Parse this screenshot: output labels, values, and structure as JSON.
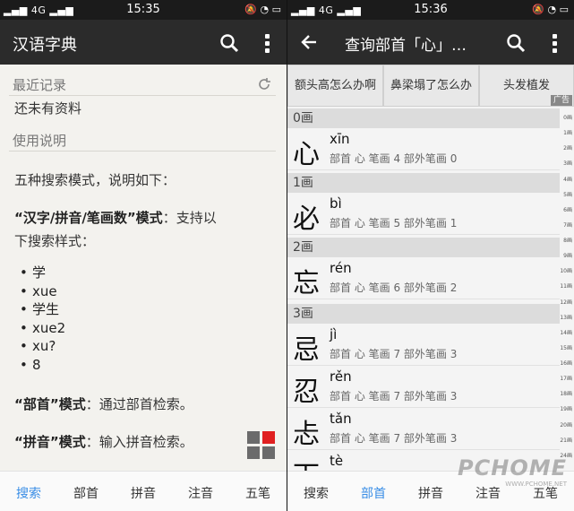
{
  "left": {
    "status": {
      "signal": "4G",
      "time": "15:35"
    },
    "appbar": {
      "title": "汉语字典"
    },
    "recent": {
      "header": "最近记录",
      "empty": "还未有资料"
    },
    "usage": {
      "header": "使用说明",
      "intro": "五种搜索模式，说明如下：",
      "mode1_bold": "“汉字/拼音/笔画数”模式",
      "mode1_rest": "：支持以",
      "mode1_cont": "下搜索样式：",
      "examples": [
        "学",
        "xue",
        "学生",
        "xue2",
        "xu?",
        "8"
      ],
      "mode2_bold": "“部首”模式",
      "mode2_rest": "：通过部首检索。",
      "mode3_bold": "“拼音”模式",
      "mode3_rest": "：输入拼音检索。"
    },
    "tabs": [
      "搜索",
      "部首",
      "拼音",
      "注音",
      "五笔"
    ],
    "active_tab": "搜索"
  },
  "right": {
    "status": {
      "signal": "4G",
      "time": "15:36"
    },
    "appbar": {
      "title": "查询部首「心」…"
    },
    "ads": [
      "额头高怎么办啊",
      "鼻梁塌了怎么办",
      "头发植发"
    ],
    "ad_tag": "广告",
    "groups": [
      {
        "header": "0画",
        "entries": [
          {
            "char": "心",
            "pinyin": "xīn",
            "meta": "部首 心   笔画 4   部外笔画 0"
          }
        ]
      },
      {
        "header": "1画",
        "entries": [
          {
            "char": "必",
            "pinyin": "bì",
            "meta": "部首 心   笔画 5   部外笔画 1"
          }
        ]
      },
      {
        "header": "2画",
        "entries": [
          {
            "char": "忘",
            "pinyin": "rén",
            "meta": "部首 心   笔画 6   部外笔画 2"
          }
        ]
      },
      {
        "header": "3画",
        "entries": [
          {
            "char": "忌",
            "pinyin": "jì",
            "meta": "部首 心   笔画 7   部外笔画 3"
          },
          {
            "char": "忍",
            "pinyin": "rěn",
            "meta": "部首 心   笔画 7   部外笔画 3"
          },
          {
            "char": "忐",
            "pinyin": "tǎn",
            "meta": "部首 心   笔画 7   部外笔画 3"
          },
          {
            "char": "下",
            "pinyin": "tè",
            "meta": ""
          }
        ]
      }
    ],
    "index": [
      "0画",
      "1画",
      "2画",
      "3画",
      "4画",
      "5画",
      "6画",
      "7画",
      "8画",
      "9画",
      "10画",
      "11画",
      "12画",
      "13画",
      "14画",
      "15画",
      "16画",
      "17画",
      "18画",
      "19画",
      "20画",
      "21画",
      "24画"
    ],
    "tabs": [
      "搜索",
      "部首",
      "拼音",
      "注音",
      "五笔"
    ],
    "active_tab": "部首"
  },
  "watermark": {
    "text": "PCHOME",
    "sub": "WWW.PCHOME.NET"
  }
}
